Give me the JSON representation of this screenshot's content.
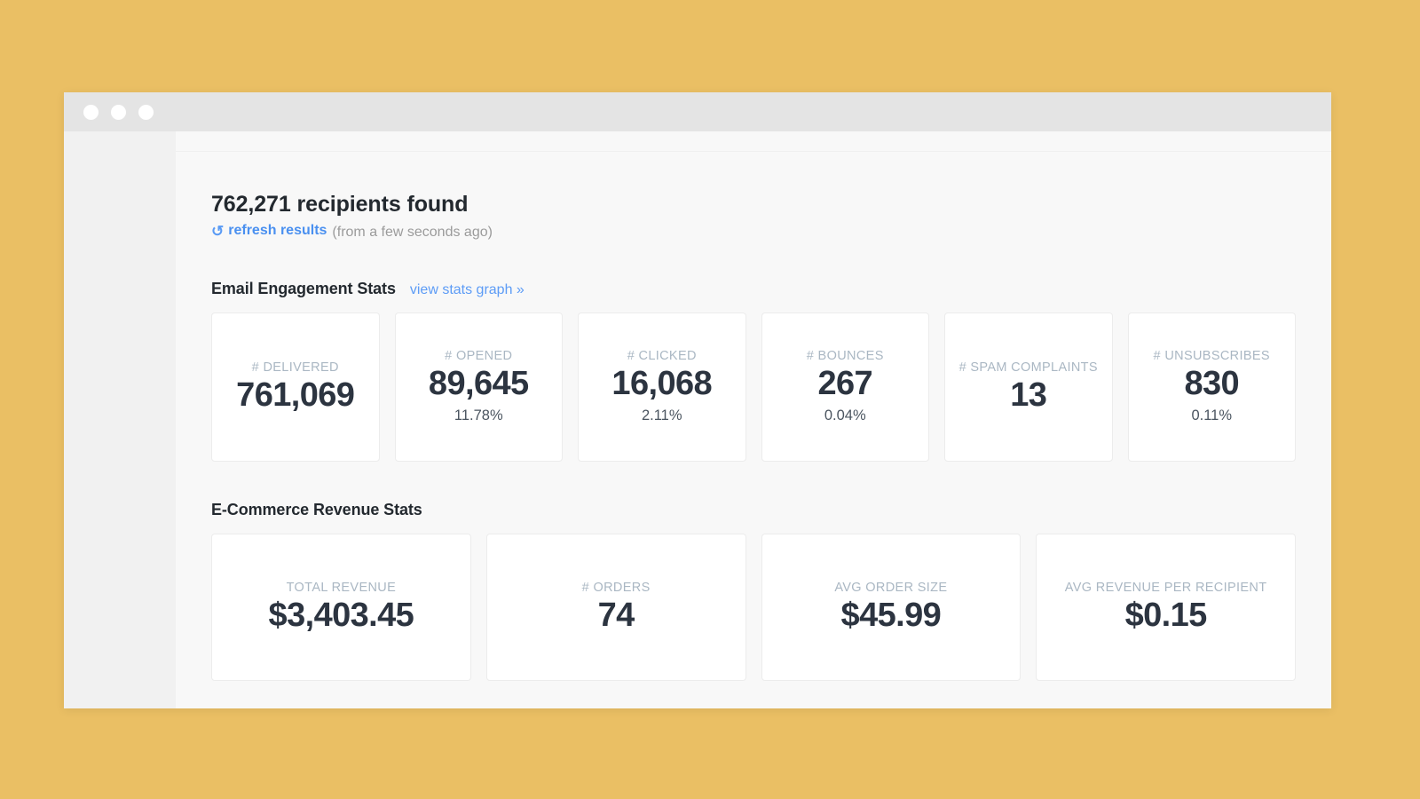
{
  "window": {
    "dots": [
      "close-dot",
      "minimize-dot",
      "maximize-dot"
    ]
  },
  "page": {
    "recipients_title": "762,271 recipients found",
    "refresh_icon": "refresh-icon",
    "refresh_label": "refresh results",
    "refresh_meta": "(from a few seconds ago)"
  },
  "engagement": {
    "title": "Email Engagement Stats",
    "link": "view stats graph »",
    "cards": [
      {
        "label": "# DELIVERED",
        "value": "761,069",
        "pct": ""
      },
      {
        "label": "# OPENED",
        "value": "89,645",
        "pct": "11.78%"
      },
      {
        "label": "# CLICKED",
        "value": "16,068",
        "pct": "2.11%"
      },
      {
        "label": "# BOUNCES",
        "value": "267",
        "pct": "0.04%"
      },
      {
        "label": "# SPAM COMPLAINTS",
        "value": "13",
        "pct": ""
      },
      {
        "label": "# UNSUBSCRIBES",
        "value": "830",
        "pct": "0.11%"
      }
    ]
  },
  "revenue": {
    "title": "E-Commerce Revenue Stats",
    "cards": [
      {
        "label": "TOTAL REVENUE",
        "value": "$3,403.45"
      },
      {
        "label": "# ORDERS",
        "value": "74"
      },
      {
        "label": "AVG ORDER SIZE",
        "value": "$45.99"
      },
      {
        "label": "AVG REVENUE PER RECIPIENT",
        "value": "$0.15"
      }
    ]
  },
  "colors": {
    "page_background": "#eabf64",
    "card_background": "#ffffff",
    "link": "#5d9cf6",
    "label": "#aab7c3",
    "value": "#2c3440"
  }
}
